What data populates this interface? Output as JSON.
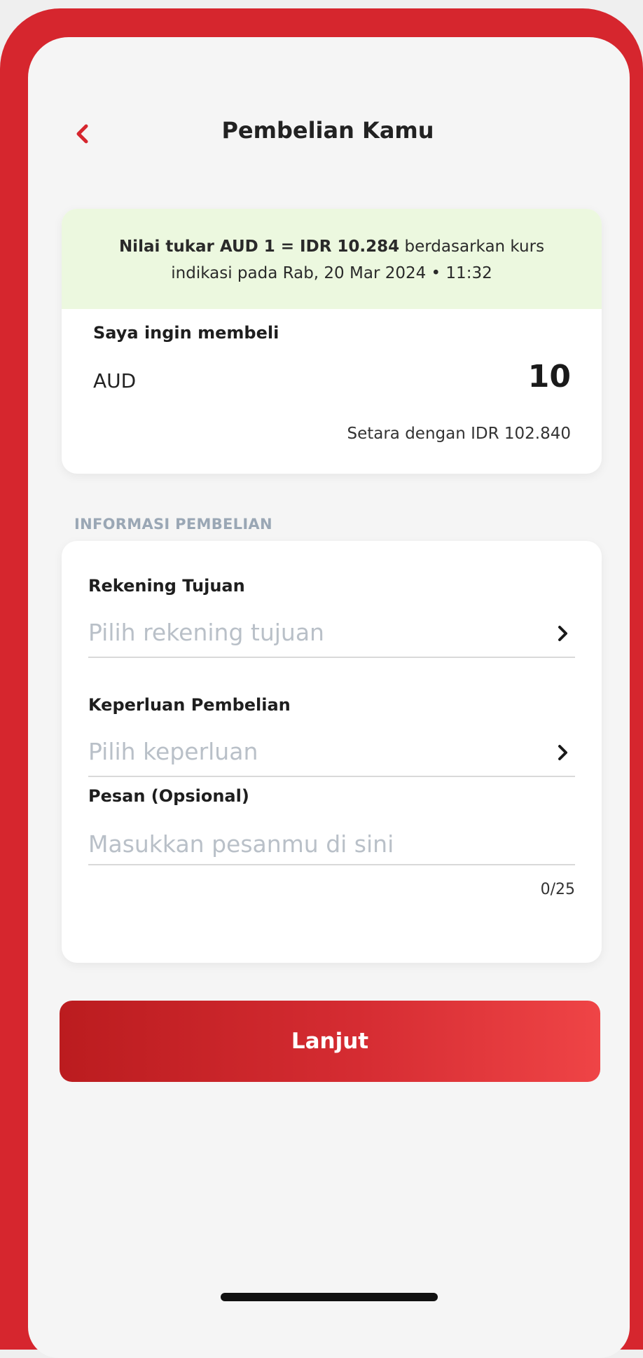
{
  "header": {
    "title": "Pembelian Kamu",
    "back_icon": "chevron-left-icon"
  },
  "rate_info": {
    "rate_text": "Nilai tukar AUD 1 = IDR 10.284",
    "rest_line1": " berdasarkan kurs",
    "line2": "indikasi pada Rab, 20 Mar 2024 • 11:32"
  },
  "purchase": {
    "label": "Saya ingin membeli",
    "currency": "AUD",
    "amount": "10",
    "equivalent": "Setara dengan IDR 102.840"
  },
  "purchase_info": {
    "section_title": "INFORMASI PEMBELIAN",
    "account": {
      "label": "Rekening Tujuan",
      "placeholder": "Pilih rekening tujuan"
    },
    "purpose": {
      "label": "Keperluan Pembelian",
      "placeholder": "Pilih keperluan"
    },
    "message": {
      "label": "Pesan (Opsional)",
      "placeholder": "Masukkan pesanmu di sini",
      "value": "",
      "counter": "0/25"
    }
  },
  "actions": {
    "continue_label": "Lanjut"
  },
  "colors": {
    "brand": "#d6262e",
    "banner_bg": "#ecf8df",
    "placeholder": "#b9c0c8",
    "section_label": "#9aa7b5"
  }
}
